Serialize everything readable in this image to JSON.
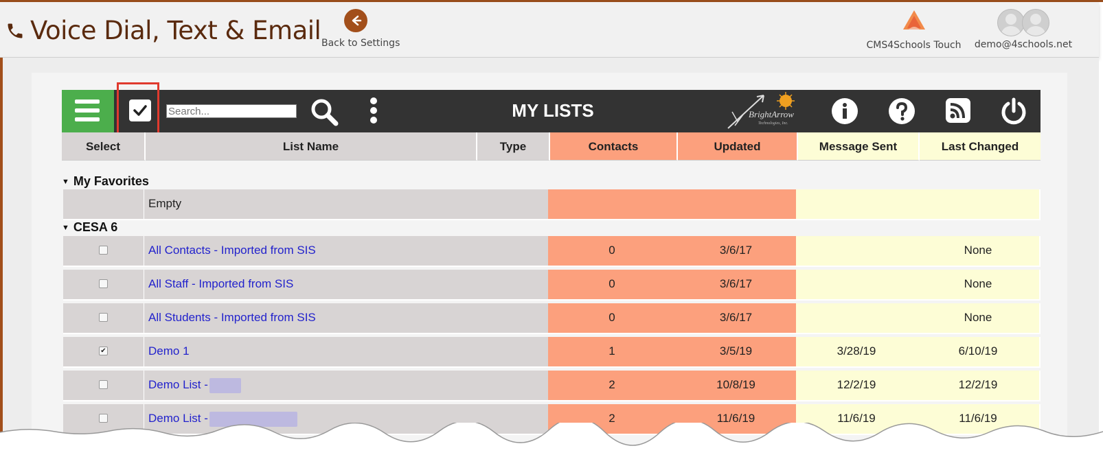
{
  "header": {
    "title": "Voice Dial, Text & Email",
    "back_label": "Back to Settings",
    "app_label": "CMS4Schools Touch",
    "user_label": "demo@4schools.net"
  },
  "toolbar": {
    "search_placeholder": "Search...",
    "title": "MY LISTS",
    "logo_text": "BrightArrow",
    "logo_subtext": "Technologies, Inc."
  },
  "table": {
    "columns": [
      "Select",
      "List Name",
      "Type",
      "Contacts",
      "Updated",
      "Message Sent",
      "Last Changed"
    ],
    "groups": [
      {
        "name": "My Favorites",
        "empty_text": "Empty"
      },
      {
        "name": "CESA 6",
        "rows": [
          {
            "name": "All Contacts - Imported from SIS",
            "type": "",
            "contacts": "0",
            "updated": "3/6/17",
            "message_sent": "",
            "last_changed": "None",
            "checked": false
          },
          {
            "name": "All Staff - Imported from SIS",
            "type": "",
            "contacts": "0",
            "updated": "3/6/17",
            "message_sent": "",
            "last_changed": "None",
            "checked": false
          },
          {
            "name": "All Students - Imported from SIS",
            "type": "",
            "contacts": "0",
            "updated": "3/6/17",
            "message_sent": "",
            "last_changed": "None",
            "checked": false
          },
          {
            "name": "Demo 1",
            "type": "",
            "contacts": "1",
            "updated": "3/5/19",
            "message_sent": "3/28/19",
            "last_changed": "6/10/19",
            "checked": true
          },
          {
            "name": "Demo List -",
            "type": "",
            "contacts": "2",
            "updated": "10/8/19",
            "message_sent": "12/2/19",
            "last_changed": "12/2/19",
            "checked": false
          },
          {
            "name": "Demo List -",
            "type": "",
            "contacts": "2",
            "updated": "11/6/19",
            "message_sent": "11/6/19",
            "last_changed": "11/6/19",
            "checked": false
          }
        ]
      }
    ]
  },
  "colors": {
    "accent_brown": "#a24f1b",
    "menu_green": "#4cae4c",
    "toolbar_bg": "#333333",
    "contacts_col": "#fca07d",
    "message_col": "#fdfdd6",
    "highlight_red": "#e03a2e"
  },
  "icons": {
    "phone": "phone-icon",
    "back": "arrow-left-icon",
    "menu": "hamburger-icon",
    "select_all": "checkmark-icon",
    "search": "search-icon",
    "more": "vertical-dots-icon",
    "info": "info-icon",
    "help": "help-icon",
    "rss": "rss-icon",
    "power": "power-icon"
  }
}
